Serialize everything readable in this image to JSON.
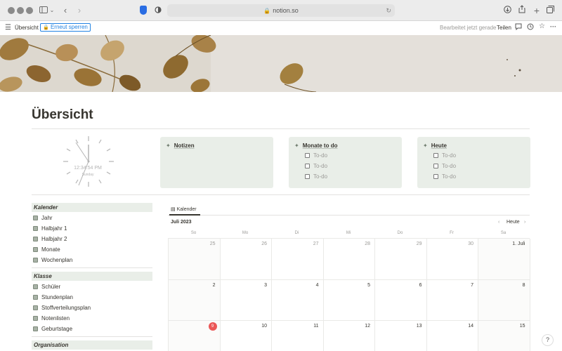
{
  "browser": {
    "url": "notion.so"
  },
  "topbar": {
    "breadcrumb": "Übersicht",
    "relock_label": "Erneut sperren",
    "edited": "Bearbeitet jetzt gerade",
    "share": "Teilen"
  },
  "page": {
    "title": "Übersicht"
  },
  "clock": {
    "time": "12:34:54 PM",
    "day": "Sunday"
  },
  "cards": {
    "notes": {
      "title": "Notizen"
    },
    "months": {
      "title": "Monate to do",
      "todos": [
        "To-do",
        "To-do",
        "To-do"
      ]
    },
    "today": {
      "title": "Heute",
      "todos": [
        "To-do",
        "To-do",
        "To-do"
      ]
    }
  },
  "sidebar": {
    "sections": [
      {
        "title": "Kalender",
        "items": [
          "Jahr",
          "Halbjahr 1",
          "Halbjahr 2",
          "Monate",
          "Wochenplan"
        ]
      },
      {
        "title": "Klasse",
        "items": [
          "Schüler",
          "Stundenplan",
          "Stoffverteilungsplan",
          "Notenlisten",
          "Geburtstage"
        ]
      },
      {
        "title": "Organisation",
        "items": []
      }
    ]
  },
  "calendar": {
    "tab_label": "Kalender",
    "month": "Juli 2023",
    "today_label": "Heute",
    "weekdays": [
      "So",
      "Mo",
      "Di",
      "Mi",
      "Do",
      "Fr",
      "Sa"
    ],
    "weeks": [
      [
        "25",
        "26",
        "27",
        "28",
        "29",
        "30",
        "1. Juli"
      ],
      [
        "2",
        "3",
        "4",
        "5",
        "6",
        "7",
        "8"
      ],
      [
        "9",
        "10",
        "11",
        "12",
        "13",
        "14",
        "15"
      ]
    ],
    "today_day": "9"
  },
  "help_label": "?",
  "colors": {
    "card_bg": "#e9eee8",
    "accent_blue": "#2383e2",
    "today_red": "#eb5757"
  }
}
